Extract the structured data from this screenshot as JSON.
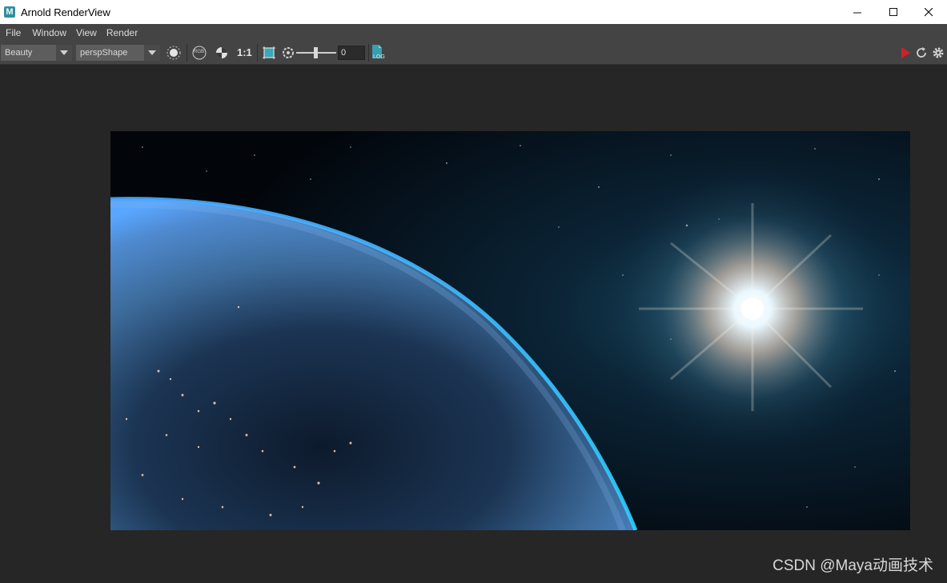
{
  "window": {
    "title": "Arnold RenderView",
    "app_icon_letter": "M"
  },
  "menu": [
    "File",
    "Window",
    "View",
    "Render"
  ],
  "toolbar": {
    "aov_value": "Beauty",
    "camera_value": "perspShape",
    "rgb_label": "RGB",
    "ratio_label": "1:1",
    "exposure_value": "0",
    "log_label": "LOG"
  },
  "colors": {
    "titlebar": "#ffffff",
    "menubar": "#444444",
    "viewport": "#262626",
    "render_play": "#d0212b",
    "log_icon": "#3a9db0"
  },
  "watermark": "CSDN @Maya动画技术"
}
